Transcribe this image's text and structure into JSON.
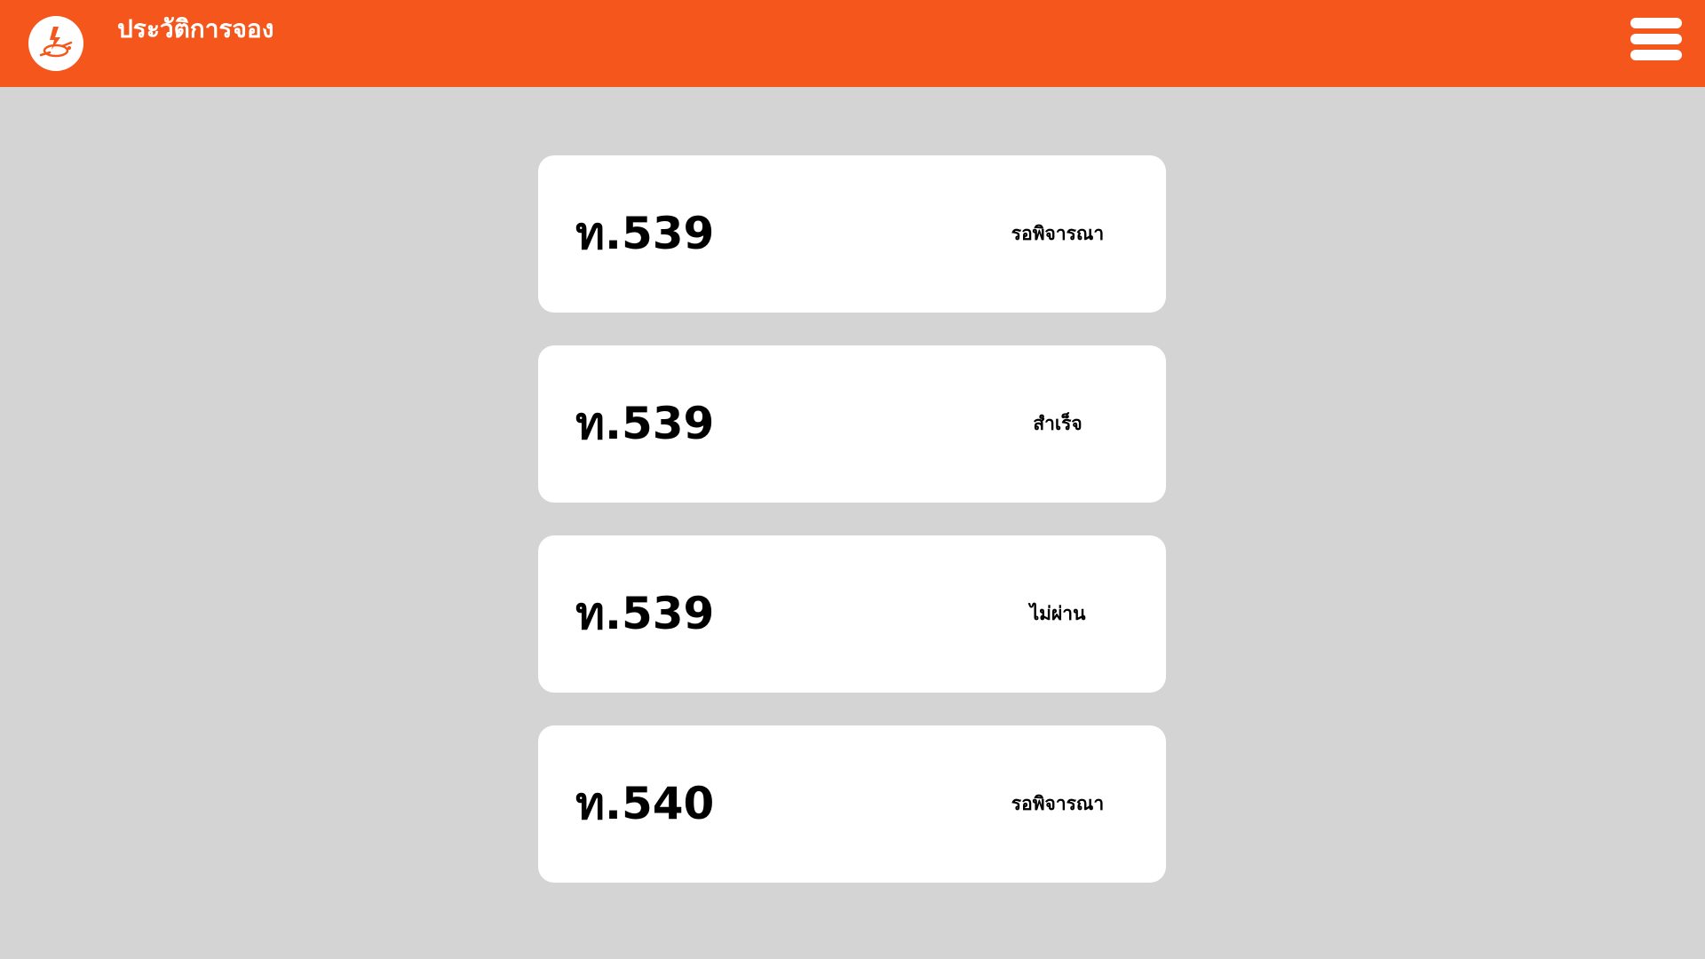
{
  "header": {
    "title": "ประวัติการจอง",
    "logo_icon": "lightning-plug-logo",
    "menu_icon": "hamburger-menu-icon",
    "background_color": "#f4561b"
  },
  "bookings": [
    {
      "code": "ท.539",
      "status": "รอพิจารณา"
    },
    {
      "code": "ท.539",
      "status": "สำเร็จ"
    },
    {
      "code": "ท.539",
      "status": "ไม่ผ่าน"
    },
    {
      "code": "ท.540",
      "status": "รอพิจารณา"
    }
  ]
}
